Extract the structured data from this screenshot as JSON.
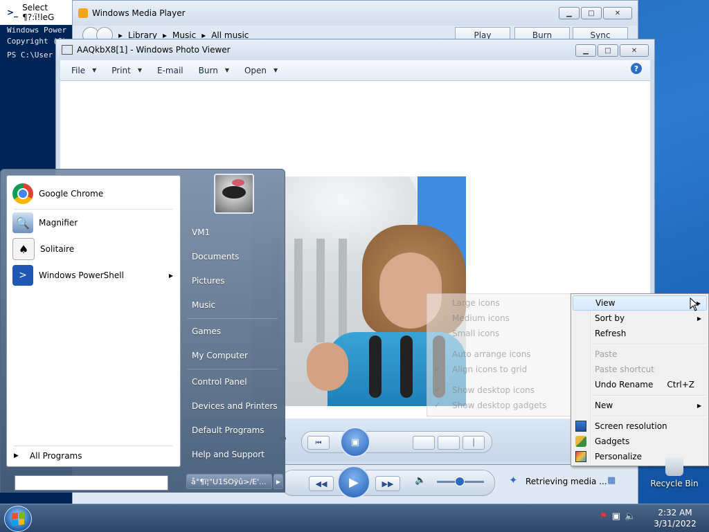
{
  "powershell": {
    "title": "Select ¶?:ï!lеG",
    "console_lines": [
      "Windows Power",
      "Copyright (C)",
      "",
      "PS C:\\User"
    ]
  },
  "media_player": {
    "title": "Windows Media Player",
    "breadcrumb": [
      "Library",
      "Music",
      "All music"
    ],
    "tabs": [
      "Play",
      "Burn",
      "Sync"
    ],
    "status": "Retrieving media ..."
  },
  "photo_viewer": {
    "title": "AAQkbX8[1] - Windows Photo Viewer",
    "menu": [
      "File",
      "Print",
      "E-mail",
      "Burn",
      "Open"
    ],
    "help": "?"
  },
  "ghost_menu": {
    "items": [
      "Large icons",
      "Medium icons",
      "Small icons",
      "Auto arrange icons",
      "Align icons to grid",
      "Show desktop icons",
      "Show desktop gadgets"
    ]
  },
  "context_menu": {
    "view": "View",
    "sort_by": "Sort by",
    "refresh": "Refresh",
    "paste": "Paste",
    "paste_shortcut": "Paste shortcut",
    "undo_rename": "Undo Rename",
    "undo_shortcut": "Ctrl+Z",
    "new": "New",
    "screen_resolution": "Screen resolution",
    "gadgets": "Gadgets",
    "personalize": "Personalize"
  },
  "start_menu": {
    "programs": [
      "Google Chrome",
      "Magnifier",
      "Solitaire",
      "Windows PowerShell"
    ],
    "all_programs": "All Programs",
    "user": "VM1",
    "right_items": [
      "Documents",
      "Pictures",
      "Music",
      "Games",
      "My Computer",
      "Control Panel",
      "Devices and Printers",
      "Default Programs",
      "Help and Support"
    ],
    "shutdown_label": "å°¶ï¦\"U1SOÿû>/E'..."
  },
  "desktop": {
    "recycle_bin": "Recycle Bin"
  },
  "taskbar": {
    "time": "2:32 AM",
    "date": "3/31/2022"
  },
  "colors": {
    "accent": "#2f6cc5",
    "taskbar": "#2c4668",
    "powershell_bg": "#012456"
  }
}
